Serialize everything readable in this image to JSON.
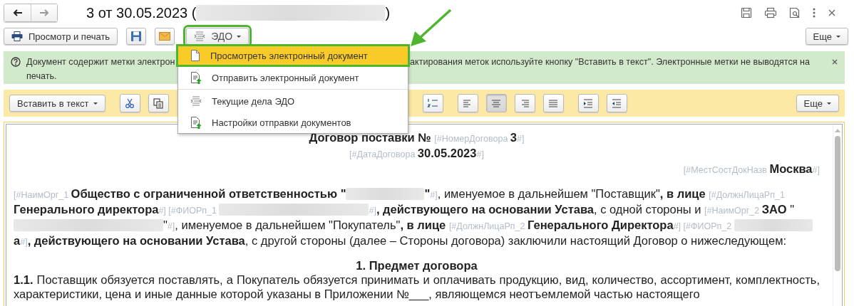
{
  "window": {
    "title": [
      {
        "kind": "text",
        "text": "3 от 30.05.2023 ("
      },
      {
        "kind": "redacted_long"
      },
      {
        "kind": "text",
        "text": ")"
      }
    ]
  },
  "command_bar": {
    "print_button": "Просмотр и печать",
    "edo_button": {
      "label": "ЭДО",
      "highlighted": true
    },
    "more_button": "Еще"
  },
  "edo_menu": {
    "groups": [
      [
        {
          "label": "Просмотреть электронный документ",
          "kind": "document",
          "selected": true,
          "highlighted": true
        },
        {
          "label": "Отправить электронный документ",
          "kind": "send",
          "selected": false,
          "highlighted": false
        }
      ],
      [
        {
          "label": "Текущие дела ЭДО",
          "kind": "exchange",
          "selected": false,
          "highlighted": false
        },
        {
          "label": "Настройки отправки документов",
          "kind": "send",
          "selected": false,
          "highlighted": false
        }
      ]
    ]
  },
  "notice": {
    "text_left": "Документ содержит метки электрон",
    "text_right": "актирования меток используйте кнопку \"Вставить в текст\". Электронные метки не выводятся на",
    "text_line2": "печать."
  },
  "editor_toolbar": {
    "insert_button": "Вставить в текст",
    "edit_tools": [
      {
        "kind": "cut"
      },
      {
        "kind": "copy"
      }
    ],
    "list_tools": [
      {
        "kind": "numbered"
      }
    ],
    "alignment": [
      {
        "kind": "left",
        "selected": false
      },
      {
        "kind": "center",
        "selected": true
      },
      {
        "kind": "right",
        "selected": false
      },
      {
        "kind": "justify",
        "selected": false
      }
    ],
    "indent_tools": [
      {
        "kind": "indent"
      },
      {
        "kind": "outdent"
      }
    ],
    "more_button": "Еще"
  },
  "document": {
    "blocks": [
      {
        "kind": "title",
        "segments": [
          {
            "kind": "bold",
            "text": "Договор поставки № "
          },
          {
            "kind": "tag",
            "text": "[#НомерДоговора "
          },
          {
            "kind": "bold",
            "text": "3"
          },
          {
            "kind": "tag",
            "text": "#]"
          }
        ]
      },
      {
        "kind": "date",
        "segments": [
          {
            "kind": "tag",
            "text": "[#ДатаДоговора "
          },
          {
            "kind": "bold",
            "text": "30.05.2023"
          },
          {
            "kind": "tag",
            "text": "#]"
          }
        ]
      },
      {
        "kind": "place",
        "segments": [
          {
            "kind": "tag",
            "text": "[#МестСостДокНазв "
          },
          {
            "kind": "bold",
            "text": "Москва"
          },
          {
            "kind": "tag",
            "text": "#]"
          }
        ]
      },
      {
        "kind": "intro",
        "segments": [
          {
            "kind": "tag",
            "text": "[#НаимОрг_1 "
          },
          {
            "kind": "bold",
            "text": "Общество с ограниченной ответственностью \""
          },
          {
            "kind": "redacted"
          },
          {
            "kind": "bold",
            "text": "\""
          },
          {
            "kind": "tag",
            "text": "#]"
          },
          {
            "kind": "text",
            "text": ", именуемое в дальнейшем \"Поставщик\""
          },
          {
            "kind": "bold",
            "text": ", в лице "
          },
          {
            "kind": "tag",
            "text": "[#ДолжнЛицаРп_1 "
          },
          {
            "kind": "bold",
            "text": "Генерального директора"
          },
          {
            "kind": "tag",
            "text": "#] [#ФИОРп_1 "
          },
          {
            "kind": "redacted_long"
          },
          {
            "kind": "tag",
            "text": "#]"
          },
          {
            "kind": "bold",
            "text": ", действующего на основании Устава"
          },
          {
            "kind": "text",
            "text": ", с одной стороны и "
          },
          {
            "kind": "tag",
            "text": "[#НаимОрг_2 "
          },
          {
            "kind": "bold",
            "text": "ЗАО "
          },
          {
            "kind": "text",
            "text": "\""
          },
          {
            "kind": "redacted_long"
          },
          {
            "kind": "text",
            "text": "\""
          },
          {
            "kind": "tag",
            "text": "#]"
          },
          {
            "kind": "text",
            "text": ", именуемое в дальнейшем \"Покупатель\""
          },
          {
            "kind": "bold",
            "text": ", в лице "
          },
          {
            "kind": "tag",
            "text": "[#ДолжнЛицаРп_2 "
          },
          {
            "kind": "bold",
            "text": "Генерального Директора"
          },
          {
            "kind": "tag",
            "text": "#] [#ФИОРп_2 "
          },
          {
            "kind": "redacted"
          },
          {
            "kind": "bold",
            "text": "а"
          },
          {
            "kind": "tag",
            "text": "#]"
          },
          {
            "kind": "bold",
            "text": ", действующего на основании Устава"
          },
          {
            "kind": "text",
            "text": ", с другой стороны (далее – Стороны договора) заключили настоящий Договор о нижеследующем:"
          }
        ]
      },
      {
        "kind": "section_heading",
        "segments": [
          {
            "kind": "bold",
            "text": "1. Предмет договора"
          }
        ]
      },
      {
        "kind": "clause",
        "segments": [
          {
            "kind": "bold",
            "text": "1.1. "
          },
          {
            "kind": "text",
            "text": "Поставщик обязуется поставлять, а Покупатель обязуется принимать и оплачивать продукцию, вид, количество, ассортимент, комплектность, характеристики, цена и иные данные которой указаны в Приложении №___, являющемся неотъемлемой частью настоящего"
          }
        ]
      }
    ]
  }
}
